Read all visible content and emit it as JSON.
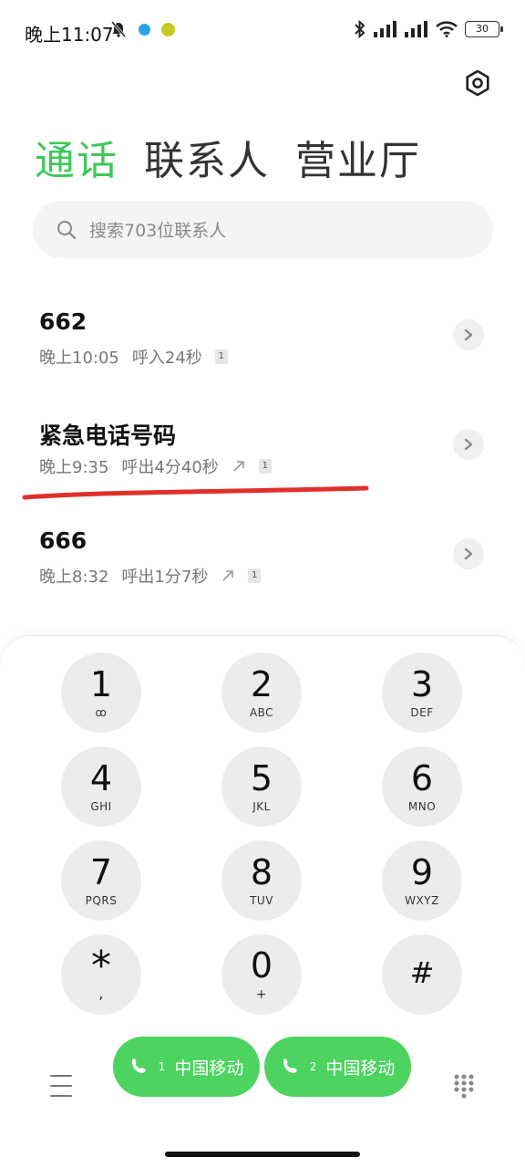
{
  "status_bar": {
    "time": "晚上11:07",
    "battery": "30"
  },
  "tabs": [
    {
      "label": "通话",
      "active": true
    },
    {
      "label": "联系人",
      "active": false
    },
    {
      "label": "营业厅",
      "active": false
    }
  ],
  "search": {
    "placeholder": "搜索703位联系人"
  },
  "call_log": [
    {
      "name": "662",
      "time": "晚上10:05",
      "detail": "呼入24秒",
      "outgoing": false,
      "sim": "1"
    },
    {
      "name": "紧急电话号码",
      "time": "晚上9:35",
      "detail": "呼出4分40秒",
      "outgoing": true,
      "sim": "1"
    },
    {
      "name": "666",
      "time": "晚上8:32",
      "detail": "呼出1分7秒",
      "outgoing": true,
      "sim": "1"
    }
  ],
  "keypad": [
    {
      "digit": "1",
      "letters": "ꝏ"
    },
    {
      "digit": "2",
      "letters": "ABC"
    },
    {
      "digit": "3",
      "letters": "DEF"
    },
    {
      "digit": "4",
      "letters": "GHI"
    },
    {
      "digit": "5",
      "letters": "JKL"
    },
    {
      "digit": "6",
      "letters": "MNO"
    },
    {
      "digit": "7",
      "letters": "PQRS"
    },
    {
      "digit": "8",
      "letters": "TUV"
    },
    {
      "digit": "9",
      "letters": "WXYZ"
    },
    {
      "digit": "*",
      "letters": ","
    },
    {
      "digit": "0",
      "letters": "+"
    },
    {
      "digit": "#",
      "letters": ""
    }
  ],
  "call_buttons": [
    {
      "sim": "1",
      "label": "中国移动"
    },
    {
      "sim": "2",
      "label": "中国移动"
    }
  ],
  "colors": {
    "accent": "#3ec75b",
    "call_button": "#4cd360",
    "annotation": "#e0302c"
  },
  "icons": [
    "bell-off-icon",
    "bluetooth-icon",
    "signal-icon",
    "wifi-icon",
    "battery-icon",
    "settings-icon",
    "search-icon",
    "chevron-right-icon",
    "outgoing-call-icon",
    "phone-icon",
    "menu-icon",
    "dialpad-icon"
  ]
}
